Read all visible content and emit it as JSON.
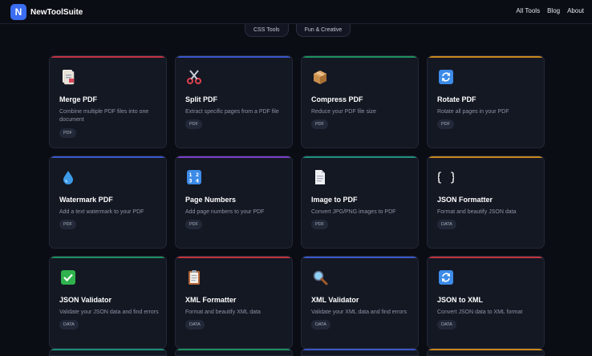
{
  "brand": {
    "logo_letter": "N",
    "name": "NewToolSuite"
  },
  "nav": [
    "All Tools",
    "Blog",
    "About"
  ],
  "categories": [
    "CSS Tools",
    "Fun & Creative"
  ],
  "tools": [
    {
      "title": "Merge PDF",
      "desc": "Combine multiple PDF files into one document",
      "tag": "PDF",
      "icon": "document-merge-icon",
      "accent": "#c0343f"
    },
    {
      "title": "Split PDF",
      "desc": "Extract specific pages from a PDF file",
      "tag": "PDF",
      "icon": "scissors-icon",
      "accent": "#3a57c9"
    },
    {
      "title": "Compress PDF",
      "desc": "Reduce your PDF file size",
      "tag": "PDF",
      "icon": "package-icon",
      "accent": "#1e8f5e"
    },
    {
      "title": "Rotate PDF",
      "desc": "Rotate all pages in your PDF",
      "tag": "PDF",
      "icon": "rotate-icon",
      "accent": "#c9871d"
    },
    {
      "title": "Watermark PDF",
      "desc": "Add a text watermark to your PDF",
      "tag": "PDF",
      "icon": "droplet-icon",
      "accent": "#3a57c9"
    },
    {
      "title": "Page Numbers",
      "desc": "Add page numbers to your PDF",
      "tag": "PDF",
      "icon": "numbers-icon",
      "accent": "#7a3fc4"
    },
    {
      "title": "Image to PDF",
      "desc": "Convert JPG/PNG images to PDF",
      "tag": "PDF",
      "icon": "page-icon",
      "accent": "#1e8f7a"
    },
    {
      "title": "JSON Formatter",
      "desc": "Format and beautify JSON data",
      "tag": "DATA",
      "icon": "braces-icon",
      "accent": "#c9871d"
    },
    {
      "title": "JSON Validator",
      "desc": "Validate your JSON data and find errors",
      "tag": "DATA",
      "icon": "check-icon",
      "accent": "#1e8f5e"
    },
    {
      "title": "XML Formatter",
      "desc": "Format and beautify XML data",
      "tag": "DATA",
      "icon": "clipboard-icon",
      "accent": "#c0343f"
    },
    {
      "title": "XML Validator",
      "desc": "Validate your XML data and find errors",
      "tag": "DATA",
      "icon": "magnifier-icon",
      "accent": "#3a57c9"
    },
    {
      "title": "JSON to XML",
      "desc": "Convert JSON data to XML format",
      "tag": "DATA",
      "icon": "convert-icon",
      "accent": "#c0343f"
    }
  ],
  "next_row_accents": [
    "#1e8f7a",
    "#1e8f5e",
    "#3a57c9",
    "#c9871d"
  ]
}
